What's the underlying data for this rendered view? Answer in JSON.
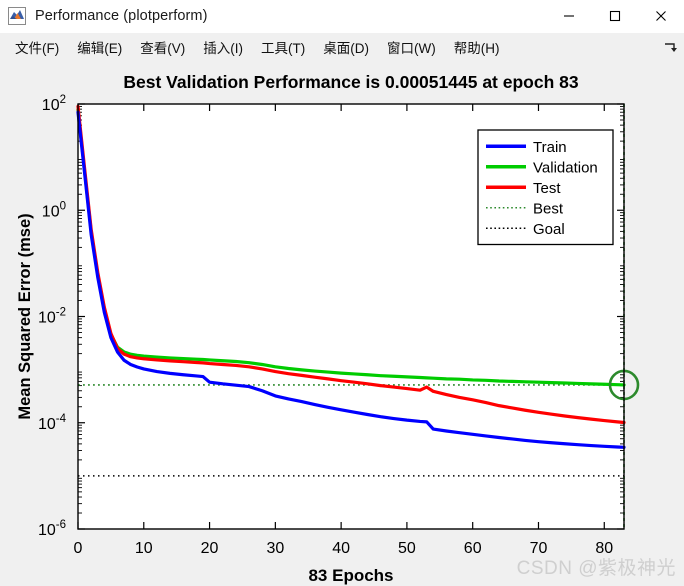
{
  "window": {
    "title": "Performance (plotperform)",
    "app_icon": "matlab-membrane-icon",
    "controls": {
      "minimize": "—",
      "maximize": "□",
      "close": "✕"
    }
  },
  "menubar": {
    "items": [
      {
        "label": "文件(F)"
      },
      {
        "label": "编辑(E)"
      },
      {
        "label": "查看(V)"
      },
      {
        "label": "插入(I)"
      },
      {
        "label": "工具(T)"
      },
      {
        "label": "桌面(D)"
      },
      {
        "label": "窗口(W)"
      },
      {
        "label": "帮助(H)"
      }
    ],
    "overflow_icon": "chevron-arrow-icon"
  },
  "watermark": {
    "text": "CSDN @紫极神光"
  },
  "colors": {
    "train": "#0000ff",
    "validation": "#00cc00",
    "test": "#ff0000",
    "best": "#2d8a2d",
    "goal": "#000000",
    "figure_bg": "#f0f0f0",
    "axes_bg": "#ffffff"
  },
  "chart_data": {
    "type": "line",
    "title": "Best Validation Performance is 0.00051445 at epoch 83",
    "xlabel": "83 Epochs",
    "ylabel": "Mean Squared Error  (mse)",
    "xlim": [
      0,
      83
    ],
    "ylim": [
      1e-06,
      100
    ],
    "yscale": "log",
    "xticks": [
      0,
      10,
      20,
      30,
      40,
      50,
      60,
      70,
      80
    ],
    "xticklabels": [
      "0",
      "10",
      "20",
      "30",
      "40",
      "50",
      "60",
      "70",
      "80"
    ],
    "yticks": [
      1e-06,
      0.0001,
      0.01,
      1,
      100
    ],
    "yticklabels": [
      "10-6",
      "10-4",
      "10-2",
      "100",
      "102"
    ],
    "ytickexponents": [
      "-6",
      "-4",
      "-2",
      "0",
      "2"
    ],
    "grid": false,
    "legend_position": "upper-right",
    "legend": [
      {
        "label": "Train",
        "color": "#0000ff",
        "style": "solid"
      },
      {
        "label": "Validation",
        "color": "#00cc00",
        "style": "solid"
      },
      {
        "label": "Test",
        "color": "#ff0000",
        "style": "solid"
      },
      {
        "label": "Best",
        "color": "#2d8a2d",
        "style": "dotted"
      },
      {
        "label": "Goal",
        "color": "#000000",
        "style": "dotted"
      }
    ],
    "annotations": {
      "best_epoch": 83,
      "best_value": 0.00051445,
      "goal_value": 1e-05,
      "best_marker": "circle"
    },
    "x": [
      0,
      1,
      2,
      3,
      4,
      5,
      6,
      7,
      8,
      9,
      10,
      12,
      14,
      16,
      18,
      19,
      20,
      22,
      24,
      26,
      28,
      30,
      32,
      34,
      36,
      38,
      40,
      42,
      44,
      46,
      48,
      50,
      52,
      53,
      54,
      56,
      58,
      60,
      62,
      64,
      66,
      68,
      70,
      72,
      74,
      76,
      78,
      80,
      82,
      83
    ],
    "series": [
      {
        "name": "Train",
        "color": "#0000ff",
        "values": [
          70,
          5.0,
          0.35,
          0.055,
          0.012,
          0.004,
          0.00215,
          0.0015,
          0.00125,
          0.00112,
          0.00103,
          0.00092,
          0.00085,
          0.0008,
          0.00076,
          0.00074,
          0.00058,
          0.00054,
          0.00051,
          0.00048,
          0.0004,
          0.00032,
          0.00028,
          0.00025,
          0.00022,
          0.000195,
          0.000175,
          0.000158,
          0.000143,
          0.00013,
          0.00012,
          0.000112,
          0.000106,
          0.000104,
          7.6e-05,
          7e-05,
          6.5e-05,
          6.05e-05,
          5.65e-05,
          5.28e-05,
          4.95e-05,
          4.65e-05,
          4.4e-05,
          4.2e-05,
          4.02e-05,
          3.86e-05,
          3.72e-05,
          3.6e-05,
          3.5e-05,
          3.45e-05
        ]
      },
      {
        "name": "Validation",
        "color": "#00cc00",
        "values": [
          78,
          5.5,
          0.4,
          0.062,
          0.014,
          0.0046,
          0.00265,
          0.00215,
          0.00195,
          0.00186,
          0.0018,
          0.00172,
          0.00166,
          0.00161,
          0.00157,
          0.00155,
          0.00152,
          0.00147,
          0.00142,
          0.00135,
          0.00125,
          0.00113,
          0.00105,
          0.00099,
          0.00094,
          0.0009,
          0.00086,
          0.00083,
          0.0008,
          0.00077,
          0.00075,
          0.00073,
          0.00071,
          0.0007,
          0.00069,
          0.00067,
          0.00066,
          0.00064,
          0.00063,
          0.00061,
          0.0006,
          0.00059,
          0.00058,
          0.00057,
          0.00056,
          0.00055,
          0.00054,
          0.00053,
          0.00052,
          0.00051445
        ]
      },
      {
        "name": "Test",
        "color": "#ff0000",
        "values": [
          90,
          6.2,
          0.44,
          0.068,
          0.015,
          0.0048,
          0.0025,
          0.00196,
          0.00175,
          0.00166,
          0.0016,
          0.00152,
          0.00146,
          0.00141,
          0.00136,
          0.00134,
          0.0013,
          0.00125,
          0.0012,
          0.00113,
          0.00103,
          0.00092,
          0.00084,
          0.00078,
          0.00072,
          0.00067,
          0.00062,
          0.00058,
          0.00054,
          0.0005,
          0.00047,
          0.00044,
          0.00041,
          0.00047,
          0.00039,
          0.00034,
          0.0003,
          0.00027,
          0.00024,
          0.00021,
          0.00019,
          0.000172,
          0.000157,
          0.000145,
          0.000134,
          0.000125,
          0.000117,
          0.00011,
          0.000104,
          0.000101
        ]
      }
    ]
  }
}
